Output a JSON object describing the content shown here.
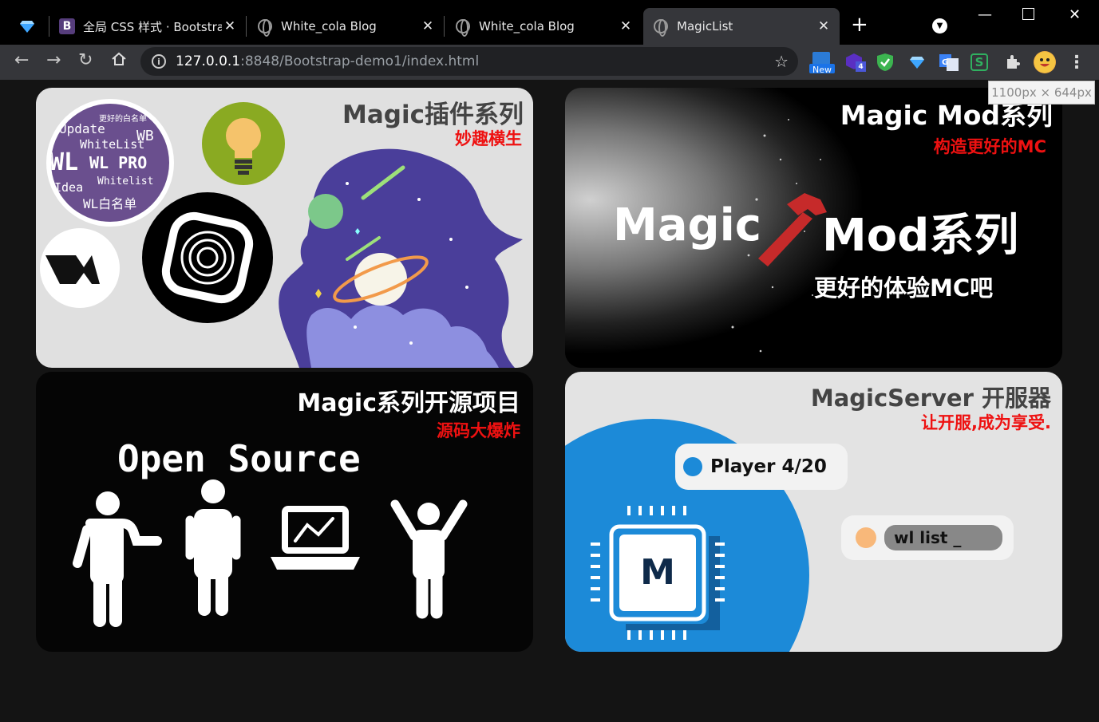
{
  "browser": {
    "tabs": [
      {
        "title": "",
        "icon": "diamond-icon"
      },
      {
        "title": "全局 CSS 样式 · Bootstra",
        "icon": "bootstrap-icon"
      },
      {
        "title": "White_cola Blog",
        "icon": "globe-icon"
      },
      {
        "title": "White_cola Blog",
        "icon": "globe-icon"
      },
      {
        "title": "MagicList",
        "icon": "globe-icon",
        "active": true
      }
    ],
    "url_host": "127.0.0.1",
    "url_rest": ":8848/Bootstrap-demo1/index.html",
    "new_badge": "New",
    "ext_count": "4",
    "size_tooltip": "1100px × 644px"
  },
  "cards": {
    "plugins": {
      "title": "Magic插件系列",
      "subtitle": "妙趣横生",
      "badge_words": [
        "更好的白名单",
        "Update",
        "WB",
        "WhiteList",
        "WL",
        "WL PRO",
        "Idea",
        "Whitelist",
        "WL白名单"
      ]
    },
    "mods": {
      "title": "Magic Mod系列",
      "subtitle": "构造更好的MC",
      "big_left": "Magic",
      "big_right": "Mod系列",
      "tagline": "更好的体验MC吧"
    },
    "opensource": {
      "title": "Magic系列开源项目",
      "subtitle": "源码大爆炸",
      "headline": "Open Source"
    },
    "server": {
      "title": "MagicServer 开服器",
      "subtitle": "让开服,成为享受.",
      "player_pill": "Player 4/20",
      "command_pill": "wl list _",
      "chip_letter": "M"
    }
  },
  "colors": {
    "title_grey": "#444444",
    "subtitle_red": "#ee1111",
    "server_blue": "#1c8ad8",
    "badge_purple": "#6a4f8e",
    "bulb_green": "#8aaa22"
  }
}
